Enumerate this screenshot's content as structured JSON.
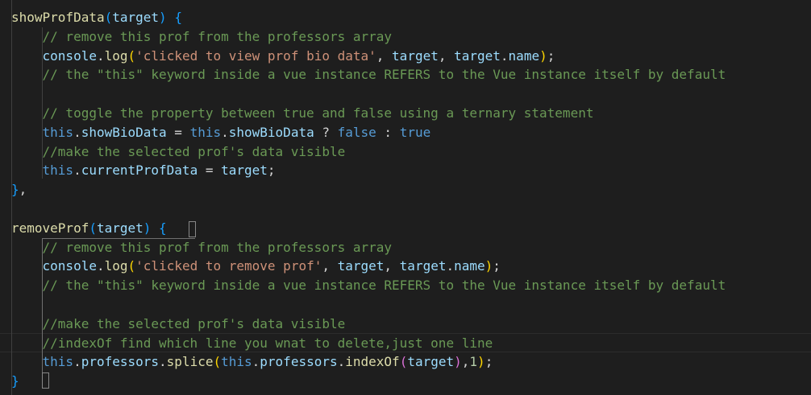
{
  "colors": {
    "background": "#1e1e1e",
    "function": "#dcdcaa",
    "comment": "#6a9955",
    "string": "#ce9178",
    "keyword": "#569cd6",
    "property": "#9cdcfe"
  },
  "editor": {
    "active_line": 17,
    "lines": [
      [
        [
          "showProfData",
          "f"
        ],
        [
          "(",
          "b"
        ],
        [
          "target",
          "p"
        ],
        [
          ")",
          "b"
        ],
        [
          " ",
          "o"
        ],
        [
          "{",
          "b"
        ]
      ],
      [
        [
          "    // remove this prof from the professors array",
          "c"
        ]
      ],
      [
        [
          "    console",
          "v"
        ],
        [
          ".",
          "o"
        ],
        [
          "log",
          "f"
        ],
        [
          "(",
          "y"
        ],
        [
          "'clicked to view prof bio data'",
          "s"
        ],
        [
          ", ",
          "o"
        ],
        [
          "target",
          "v"
        ],
        [
          ", ",
          "o"
        ],
        [
          "target",
          "v"
        ],
        [
          ".",
          "o"
        ],
        [
          "name",
          "v"
        ],
        [
          ")",
          "y"
        ],
        [
          ";",
          "o"
        ]
      ],
      [
        [
          "    // the \"this\" keyword inside a vue instance REFERS to the Vue instance itself by default",
          "c"
        ]
      ],
      [],
      [
        [
          "    // toggle the property between true and false using a ternary statement",
          "c"
        ]
      ],
      [
        [
          "    this",
          "k"
        ],
        [
          ".",
          "o"
        ],
        [
          "showBioData",
          "v"
        ],
        [
          " = ",
          "o"
        ],
        [
          "this",
          "k"
        ],
        [
          ".",
          "o"
        ],
        [
          "showBioData",
          "v"
        ],
        [
          " ? ",
          "o"
        ],
        [
          "false",
          "k"
        ],
        [
          " : ",
          "o"
        ],
        [
          "true",
          "k"
        ]
      ],
      [
        [
          "    //make the selected prof's data visible",
          "c"
        ]
      ],
      [
        [
          "    this",
          "k"
        ],
        [
          ".",
          "o"
        ],
        [
          "currentProfData",
          "v"
        ],
        [
          " = ",
          "o"
        ],
        [
          "target",
          "v"
        ],
        [
          ";",
          "o"
        ]
      ],
      [
        [
          "}",
          "b"
        ],
        [
          ",",
          "o"
        ]
      ],
      [],
      [
        [
          "removeProf",
          "f"
        ],
        [
          "(",
          "b"
        ],
        [
          "target",
          "p"
        ],
        [
          ")",
          "b"
        ],
        [
          " ",
          "o"
        ],
        [
          "{",
          "b"
        ]
      ],
      [
        [
          "    // remove this prof from the professors array",
          "c"
        ]
      ],
      [
        [
          "    console",
          "v"
        ],
        [
          ".",
          "o"
        ],
        [
          "log",
          "f"
        ],
        [
          "(",
          "y"
        ],
        [
          "'clicked to remove prof'",
          "s"
        ],
        [
          ", ",
          "o"
        ],
        [
          "target",
          "v"
        ],
        [
          ", ",
          "o"
        ],
        [
          "target",
          "v"
        ],
        [
          ".",
          "o"
        ],
        [
          "name",
          "v"
        ],
        [
          ")",
          "y"
        ],
        [
          ";",
          "o"
        ]
      ],
      [
        [
          "    // the \"this\" keyword inside a vue instance REFERS to the Vue instance itself by default",
          "c"
        ]
      ],
      [],
      [
        [
          "    //make the selected prof's data visible",
          "c"
        ]
      ],
      [
        [
          "    //indexOf find which line you wnat to delete,just one line",
          "c"
        ]
      ],
      [
        [
          "    this",
          "k"
        ],
        [
          ".",
          "o"
        ],
        [
          "professors",
          "v"
        ],
        [
          ".",
          "o"
        ],
        [
          "splice",
          "f"
        ],
        [
          "(",
          "y"
        ],
        [
          "this",
          "k"
        ],
        [
          ".",
          "o"
        ],
        [
          "professors",
          "v"
        ],
        [
          ".",
          "o"
        ],
        [
          "indexOf",
          "f"
        ],
        [
          "(",
          "m"
        ],
        [
          "target",
          "v"
        ],
        [
          ")",
          "m"
        ],
        [
          ",",
          "o"
        ],
        [
          "1",
          "n"
        ],
        [
          ")",
          "y"
        ],
        [
          ";",
          "o"
        ]
      ],
      [
        [
          "}",
          "b"
        ]
      ]
    ]
  }
}
